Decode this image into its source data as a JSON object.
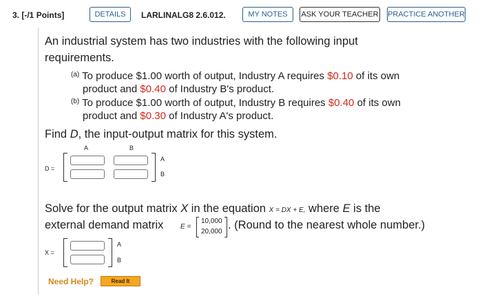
{
  "question": {
    "number": "3.",
    "points": "[-/1 Points]",
    "reference": "LARLINALG8 2.6.012."
  },
  "buttons": {
    "details": "DETAILS",
    "my_notes": "MY NOTES",
    "ask_teacher": "ASK YOUR TEACHER",
    "practice": "PRACTICE ANOTHER"
  },
  "problem": {
    "intro_line1": "An industrial system has two industries with the following input",
    "intro_line2": "requirements.",
    "item_a": {
      "marker": "(a)",
      "line1_pre": "To produce $1.00 worth of output, Industry A requires ",
      "line1_val": "$0.10",
      "line1_post": " of its own",
      "line2_pre": "product and ",
      "line2_val": "$0.40",
      "line2_post": " of Industry B's product."
    },
    "item_b": {
      "marker": "(b)",
      "line1_pre": "To produce $1.00 worth of output, Industry B requires ",
      "line1_val": "$0.40",
      "line1_post": " of its own",
      "line2_pre": "product and ",
      "line2_val": "$0.30",
      "line2_post": " of Industry A's product."
    },
    "find_pre": "Find ",
    "find_var": "D",
    "find_post": ", the input-output matrix for this system."
  },
  "matrix_d": {
    "label": "D =",
    "col_a": "A",
    "col_b": "B",
    "row_a": "A",
    "row_b": "B"
  },
  "solve": {
    "line1_pre": "Solve for the output matrix ",
    "line1_var": "X",
    "line1_mid": " in the equation ",
    "equation": "X = DX + E,",
    "line1_post": " where ",
    "line1_var2": "E",
    "line1_end": " is the",
    "line2_pre": "external demand matrix ",
    "e_label": "E =",
    "e_values": [
      "10,000",
      "20,000"
    ],
    "line2_post": ". (Round to the nearest whole number.)"
  },
  "matrix_x": {
    "label": "X =",
    "row_a": "A",
    "row_b": "B"
  },
  "help": {
    "label": "Need Help?",
    "read_it": "Read It"
  },
  "colors": {
    "link_blue": "#2a5d8f",
    "value_red": "#d0281a",
    "help_orange": "#d08a1a",
    "button_orange": "#f5a623"
  }
}
